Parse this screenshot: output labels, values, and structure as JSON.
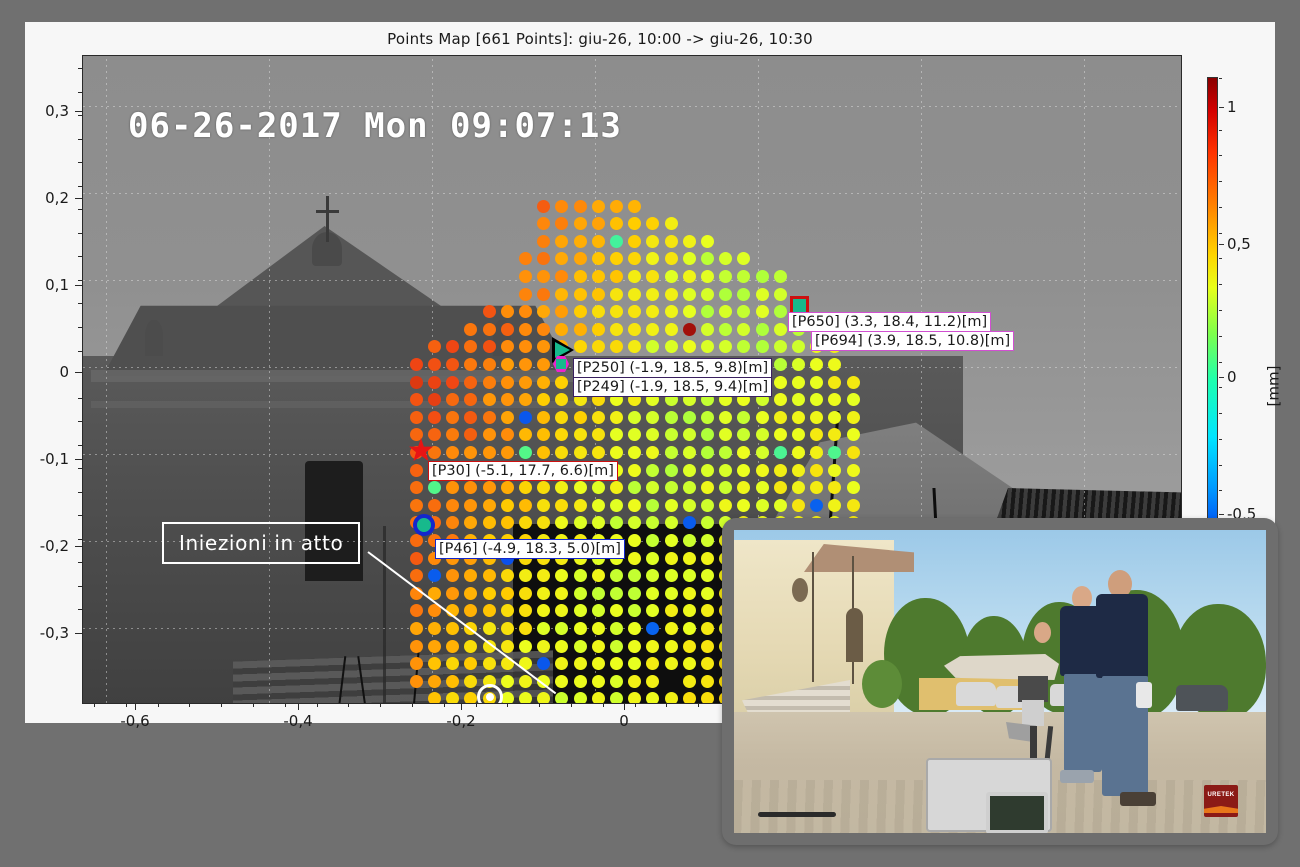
{
  "figure": {
    "title": "Points Map [661 Points]: giu-26, 10:00 -> giu-26, 10:30",
    "points_count": 661,
    "time_from": "giu-26, 10:00",
    "time_to": "giu-26, 10:30"
  },
  "axes": {
    "x_ticks": [
      "-0,6",
      "-0,4",
      "-0,2",
      "0"
    ],
    "y_ticks": [
      "0,3",
      "0,2",
      "0,1",
      "0",
      "-0,1",
      "-0,2",
      "-0,3"
    ],
    "x_range": [
      -0.7,
      0.12
    ],
    "y_range": [
      -0.37,
      0.37
    ]
  },
  "colorbar": {
    "unit": "[mm]",
    "ticks": [
      "1",
      "0,5",
      "0",
      "-0,5"
    ],
    "range": [
      -0.62,
      1.25
    ],
    "colormap": "jet",
    "colors": [
      "#8a0000",
      "#ff3300",
      "#ff7f00",
      "#ffd500",
      "#7cff4d",
      "#00e5ff",
      "#0033ee"
    ]
  },
  "overlay": {
    "timestamp": "06-26-2017 Mon 09:07:13",
    "annotation": "Iniezioni in atto"
  },
  "point_labels": [
    {
      "id": "P650",
      "text": "[P650] (3.3, 18.4, 11.2)[m]",
      "marker": "square",
      "marker_color": "#17b98c",
      "border_color": "#cc1010"
    },
    {
      "id": "P694",
      "text": "[P694] (3.9, 18.5, 10.8)[m]",
      "marker": "arrow",
      "marker_color": "#cc22cc",
      "border_color": "#d14fd1"
    },
    {
      "id": "P250",
      "text": "[P250] (-1.9, 18.5, 9.8)[m]",
      "marker": "triangle",
      "marker_color": "#17b98c",
      "border_color": "#3a2060"
    },
    {
      "id": "P249",
      "text": "[P249] (-1.9, 18.5, 9.4)[m]",
      "marker": "hexagon",
      "marker_color": "#17b98c",
      "border_color": "#ee22cc"
    },
    {
      "id": "P30",
      "text": "[P30] (-5.1, 17.7, 6.6)[m]",
      "marker": "star",
      "marker_color": "#e81414",
      "border_color": "#cc1010"
    },
    {
      "id": "P46",
      "text": "[P46] (-4.9, 18.3, 5.0)[m]",
      "marker": "circle",
      "marker_color": "#17b98c",
      "border_color": "#1427cc"
    }
  ],
  "inset": {
    "logo_text": "URETEK",
    "logo_color": "#8b1a16"
  },
  "chart_data": {
    "type": "scatter",
    "title": "Points Map [661 Points]: giu-26, 10:00 -> giu-26, 10:30",
    "xlabel": "",
    "ylabel": "",
    "clabel": "[mm]",
    "xlim": [
      -0.7,
      0.12
    ],
    "ylim": [
      -0.37,
      0.37
    ],
    "clim": [
      -0.62,
      1.25
    ],
    "grid": true,
    "colormap": "jet",
    "n_points": 661,
    "background": "grayscale radar image of church facade",
    "xticks": [
      -0.6,
      -0.4,
      -0.2,
      0
    ],
    "yticks": [
      0.3,
      0.2,
      0.1,
      0,
      -0.1,
      -0.2,
      -0.3
    ],
    "cticks": [
      1,
      0.5,
      0,
      -0.5
    ],
    "highlighted_points": [
      {
        "id": "P650",
        "coords": [
          3.3,
          18.4,
          11.2
        ],
        "unit": "m"
      },
      {
        "id": "P694",
        "coords": [
          3.9,
          18.5,
          10.8
        ],
        "unit": "m"
      },
      {
        "id": "P250",
        "coords": [
          -1.9,
          18.5,
          9.8
        ],
        "unit": "m"
      },
      {
        "id": "P249",
        "coords": [
          -1.9,
          18.5,
          9.4
        ],
        "unit": "m"
      },
      {
        "id": "P30",
        "coords": [
          -5.1,
          17.7,
          6.6
        ],
        "unit": "m"
      },
      {
        "id": "P46",
        "coords": [
          -4.9,
          18.3,
          5.0
        ],
        "unit": "m"
      }
    ]
  }
}
